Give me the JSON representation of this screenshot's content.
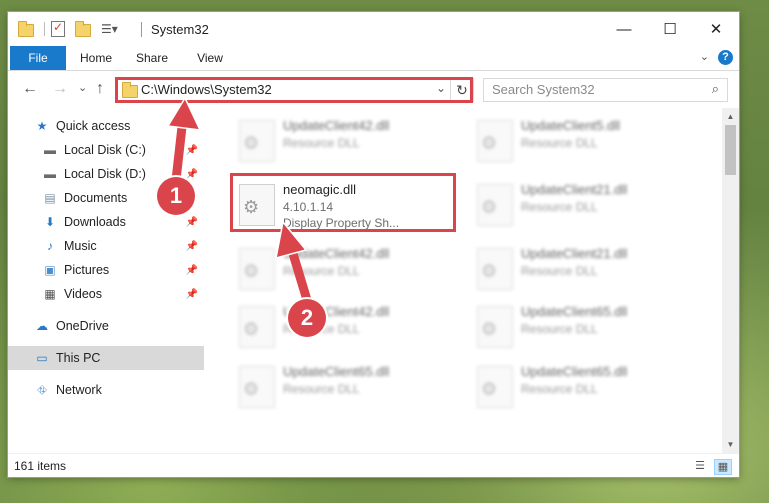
{
  "window": {
    "title": "System32",
    "controls": {
      "minimize": "—",
      "maximize": "☐",
      "close": "✕"
    }
  },
  "ribbon": {
    "tabs": [
      "File",
      "Home",
      "Share",
      "View"
    ],
    "help": "?"
  },
  "nav": {
    "back": "←",
    "forward": "→",
    "recent": "⌄",
    "up": "↑",
    "address": "C:\\Windows\\System32",
    "address_dropdown": "⌄",
    "refresh": "↻",
    "search_placeholder": "Search System32",
    "search_icon": "⌕"
  },
  "sidebar": {
    "items": [
      {
        "label": "Quick access",
        "icon": "star-icon",
        "glyph": "★"
      },
      {
        "label": "Local Disk (C:)",
        "icon": "drive-icon",
        "glyph": "▬",
        "pinned": true
      },
      {
        "label": "Local Disk (D:)",
        "icon": "drive-icon",
        "glyph": "▬",
        "pinned": true
      },
      {
        "label": "Documents",
        "icon": "documents-icon",
        "glyph": "▤",
        "pinned": true
      },
      {
        "label": "Downloads",
        "icon": "downloads-icon",
        "glyph": "⬇",
        "pinned": true
      },
      {
        "label": "Music",
        "icon": "music-icon",
        "glyph": "♪",
        "pinned": true
      },
      {
        "label": "Pictures",
        "icon": "pictures-icon",
        "glyph": "▣",
        "pinned": true
      },
      {
        "label": "Videos",
        "icon": "videos-icon",
        "glyph": "▦",
        "pinned": true
      },
      {
        "label": "OneDrive",
        "icon": "cloud-icon",
        "glyph": "☁"
      },
      {
        "label": "This PC",
        "icon": "computer-icon",
        "glyph": "▭"
      },
      {
        "label": "Network",
        "icon": "network-icon",
        "glyph": "⛗"
      }
    ],
    "pin_glyph": "📌"
  },
  "files": {
    "left_column": [
      {
        "name": "UpdateClient42.dll",
        "type": "Resource DLL"
      },
      {
        "name": "neomagic.dll",
        "version": "4.10.1.14",
        "description": "Display Property Sh..."
      },
      {
        "name": "UpdateClient42.dll",
        "type": "Resource DLL"
      },
      {
        "name": "UpdateClient42.dll",
        "type": "Resource DLL"
      },
      {
        "name": "UpdateClient65.dll",
        "type": "Resource DLL"
      }
    ],
    "right_column": [
      {
        "name": "UpdateClient5.dll",
        "type": "Resource DLL"
      },
      {
        "name": "UpdateClient21.dll",
        "type": "Resource DLL"
      },
      {
        "name": "UpdateClient21.dll",
        "type": "Resource DLL"
      },
      {
        "name": "UpdateClient65.dll",
        "type": "Resource DLL"
      },
      {
        "name": "UpdateClient65.dll",
        "type": "Resource DLL"
      }
    ]
  },
  "status": {
    "item_count": "161 items"
  },
  "annotations": {
    "badge1": "1",
    "badge2": "2",
    "color": "#d9454b"
  }
}
